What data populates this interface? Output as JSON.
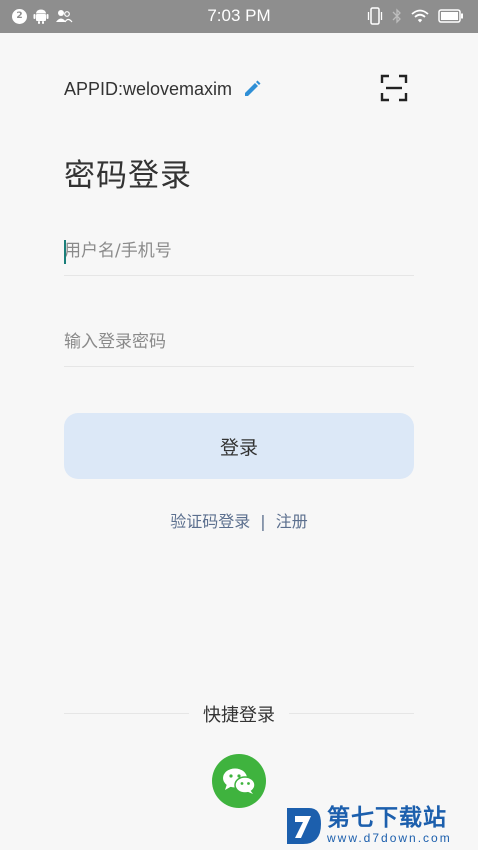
{
  "status_bar": {
    "notification_count": "2",
    "time": "7:03 PM",
    "icons": [
      "android-icon",
      "people-icon",
      "vibrate-icon",
      "bluetooth-icon",
      "wifi-icon",
      "battery-icon"
    ]
  },
  "header": {
    "appid_text": "APPID:welovemaxim",
    "edit_icon": "pencil-icon",
    "scan_icon": "scan-icon"
  },
  "page": {
    "title": "密码登录"
  },
  "form": {
    "username_placeholder": "用户名/手机号",
    "password_placeholder": "输入登录密码",
    "login_label": "登录"
  },
  "links": {
    "sms_login": "验证码登录",
    "separator": "|",
    "register": "注册"
  },
  "quick_login": {
    "title": "快捷登录",
    "icon": "wechat-icon"
  },
  "watermark": {
    "cn": "第七下载站",
    "en": "www.d7down.com"
  },
  "colors": {
    "accent_button": "#dce8f7",
    "link": "#5b6f8e",
    "wechat_green": "#3fb33e",
    "edit_blue": "#2f8fd6"
  }
}
